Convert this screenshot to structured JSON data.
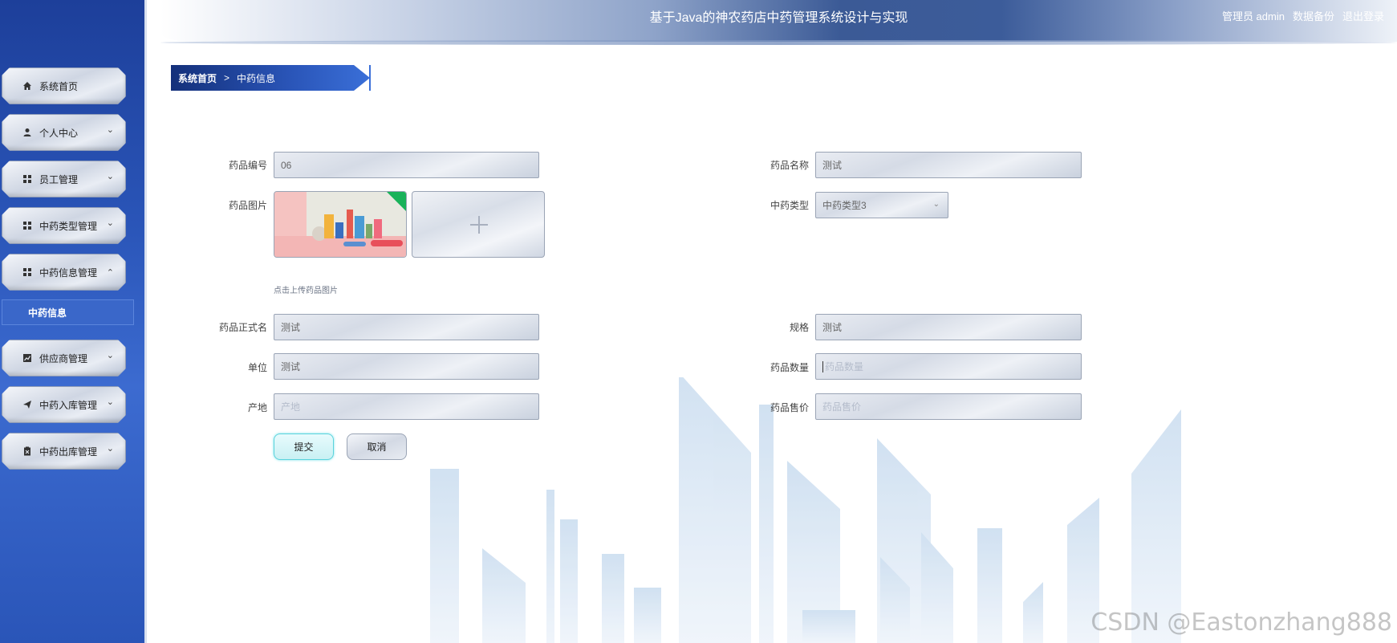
{
  "header": {
    "title": "基于Java的神农药店中药管理系统设计与实现",
    "user_label": "管理员 admin",
    "backup_label": "数据备份",
    "logout_label": "退出登录"
  },
  "sidebar": {
    "items": [
      {
        "label": "系统首页",
        "icon": "home-icon"
      },
      {
        "label": "个人中心",
        "icon": "user-icon"
      },
      {
        "label": "员工管理",
        "icon": "grid-icon"
      },
      {
        "label": "中药类型管理",
        "icon": "grid-icon"
      },
      {
        "label": "中药信息管理",
        "icon": "grid-icon"
      },
      {
        "label": "供应商管理",
        "icon": "chart-icon"
      },
      {
        "label": "中药入库管理",
        "icon": "send-icon"
      },
      {
        "label": "中药出库管理",
        "icon": "clipboard-icon"
      }
    ],
    "sub_item": "中药信息"
  },
  "breadcrumb": {
    "home": "系统首页",
    "separator": ">",
    "current": "中药信息"
  },
  "form": {
    "drug_no": {
      "label": "药品编号",
      "value": "06"
    },
    "drug_name": {
      "label": "药品名称",
      "value": "测试"
    },
    "drug_image": {
      "label": "药品图片",
      "hint": "点击上传药品图片"
    },
    "tcm_type": {
      "label": "中药类型",
      "value": "中药类型3"
    },
    "formal_name": {
      "label": "药品正式名",
      "value": "测试"
    },
    "spec": {
      "label": "规格",
      "value": "测试"
    },
    "unit": {
      "label": "单位",
      "value": "测试"
    },
    "quantity": {
      "label": "药品数量",
      "placeholder": "药品数量"
    },
    "origin": {
      "label": "产地",
      "placeholder": "产地"
    },
    "price": {
      "label": "药品售价",
      "placeholder": "药品售价"
    }
  },
  "buttons": {
    "submit": "提交",
    "cancel": "取消"
  },
  "watermark": "CSDN @Eastonzhang888"
}
